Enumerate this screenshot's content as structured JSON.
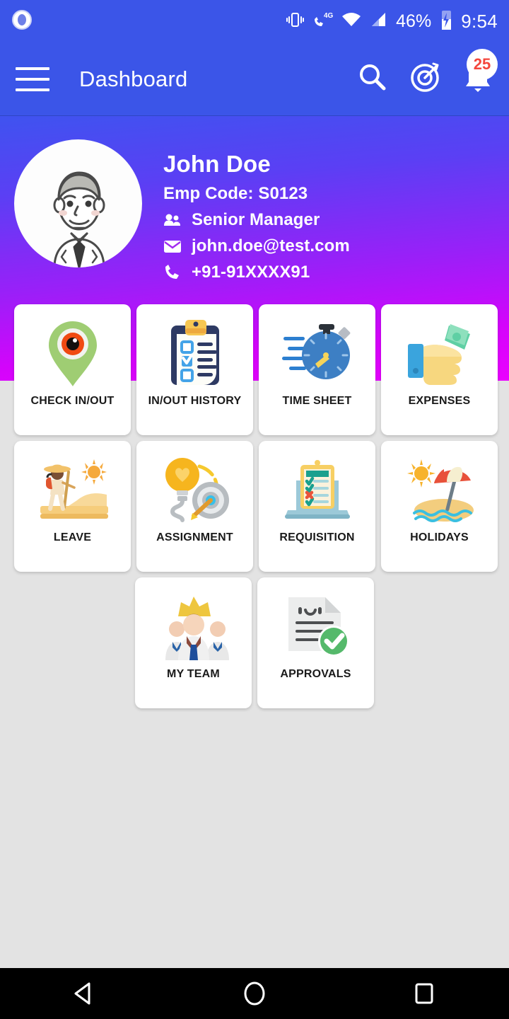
{
  "status_bar": {
    "vibrate_icon": "vibrate-icon",
    "call_4g_icon": "phone-4g-icon",
    "wifi_icon": "wifi-icon",
    "signal_icon": "cellular-signal-icon",
    "battery_percent": "46%",
    "battery_icon": "battery-charging-icon",
    "clock": "9:54",
    "left_app_icon": "app-status-icon",
    "background_color": "#3b55e8"
  },
  "app_bar": {
    "menu_icon": "hamburger-menu-icon",
    "title": "Dashboard",
    "search_icon": "search-icon",
    "target_icon": "target-goal-icon",
    "notification_icon": "notification-bell-icon",
    "notification_count": "25",
    "badge_text_color": "#f4463c",
    "background_color": "#3b55e8"
  },
  "profile": {
    "avatar_icon": "user-avatar-illustration",
    "name": "John Doe",
    "emp_code": "Emp Code: S0123",
    "designation": "Senior Manager",
    "designation_icon": "people-icon",
    "email": "john.doe@test.com",
    "email_icon": "envelope-icon",
    "phone": "+91-91XXXX91",
    "phone_icon": "phone-icon",
    "gradient_start": "#3f53f0",
    "gradient_end": "#ea00ff"
  },
  "menu_grid": {
    "rows": [
      [
        {
          "label": "CHECK IN/OUT",
          "icon": "location-pin-eye-icon"
        },
        {
          "label": "IN/OUT HISTORY",
          "icon": "clipboard-checklist-icon"
        },
        {
          "label": "TIME SHEET",
          "icon": "stopwatch-icon"
        },
        {
          "label": "EXPENSES",
          "icon": "hand-cash-icon"
        }
      ],
      [
        {
          "label": "LEAVE",
          "icon": "hiker-sun-icon"
        },
        {
          "label": "ASSIGNMENT",
          "icon": "lightbulb-target-icon"
        },
        {
          "label": "REQUISITION",
          "icon": "laptop-clipboard-icon"
        },
        {
          "label": "HOLIDAYS",
          "icon": "beach-umbrella-icon"
        }
      ],
      [
        {
          "label": "MY TEAM",
          "icon": "team-gear-icon"
        },
        {
          "label": "APPROVALS",
          "icon": "document-check-icon"
        }
      ]
    ]
  },
  "nav_bar": {
    "back_icon": "android-back-icon",
    "home_icon": "android-home-icon",
    "recents_icon": "android-recents-icon",
    "background_color": "#000000"
  }
}
